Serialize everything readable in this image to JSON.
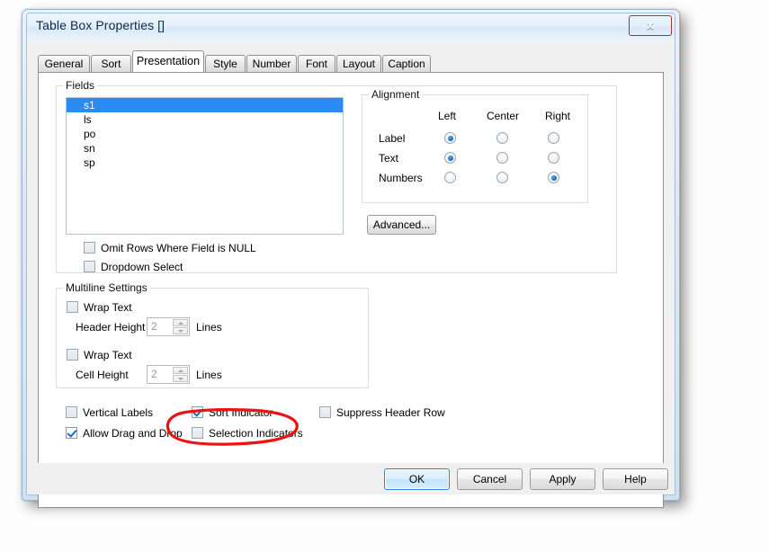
{
  "window": {
    "title": "Table Box Properties []",
    "close_label": "x",
    "close_icon": "close-icon"
  },
  "tabs": [
    {
      "label": "General",
      "active": false
    },
    {
      "label": "Sort",
      "active": false
    },
    {
      "label": "Presentation",
      "active": true
    },
    {
      "label": "Style",
      "active": false
    },
    {
      "label": "Number",
      "active": false
    },
    {
      "label": "Font",
      "active": false
    },
    {
      "label": "Layout",
      "active": false
    },
    {
      "label": "Caption",
      "active": false
    }
  ],
  "fields_group": {
    "legend": "Fields",
    "items": [
      {
        "label": "s1",
        "selected": true
      },
      {
        "label": "ls",
        "selected": false
      },
      {
        "label": "po",
        "selected": false
      },
      {
        "label": "sn",
        "selected": false
      },
      {
        "label": "sp",
        "selected": false
      }
    ],
    "checkboxes": [
      {
        "label": "Omit Rows Where Field is NULL",
        "checked": false
      },
      {
        "label": "Dropdown Select",
        "checked": false
      }
    ]
  },
  "alignment_group": {
    "legend": "Alignment",
    "columns": [
      "Left",
      "Center",
      "Right"
    ],
    "rows": [
      {
        "label": "Label",
        "selected": "Left"
      },
      {
        "label": "Text",
        "selected": "Left"
      },
      {
        "label": "Numbers",
        "selected": "Right"
      }
    ],
    "advanced_button": "Advanced..."
  },
  "multiline_group": {
    "legend": "Multiline Settings",
    "header": {
      "wrap_label": "Wrap Text",
      "wrap_checked": false,
      "height_label": "Header Height",
      "value": "2",
      "units": "Lines"
    },
    "cell": {
      "wrap_label": "Wrap Text",
      "wrap_checked": false,
      "height_label": "Cell Height",
      "value": "2",
      "units": "Lines"
    }
  },
  "options": [
    {
      "label": "Vertical Labels",
      "checked": false
    },
    {
      "label": "Sort Indicator",
      "checked": true
    },
    {
      "label": "Suppress Header Row",
      "checked": false
    },
    {
      "label": "Allow Drag and Drop",
      "checked": true
    },
    {
      "label": "Selection Indicators",
      "checked": false
    }
  ],
  "footer_buttons": [
    {
      "label": "OK",
      "default": true
    },
    {
      "label": "Cancel",
      "default": false
    },
    {
      "label": "Apply",
      "default": false
    },
    {
      "label": "Help",
      "default": false
    }
  ],
  "annotation": {
    "shape": "ellipse",
    "color": "#ee1111",
    "target": "Selection Indicators"
  },
  "colors": {
    "selection_blue": "#2a8bf2",
    "annotation_red": "#ee1111",
    "title_text": "#0b2a45"
  }
}
